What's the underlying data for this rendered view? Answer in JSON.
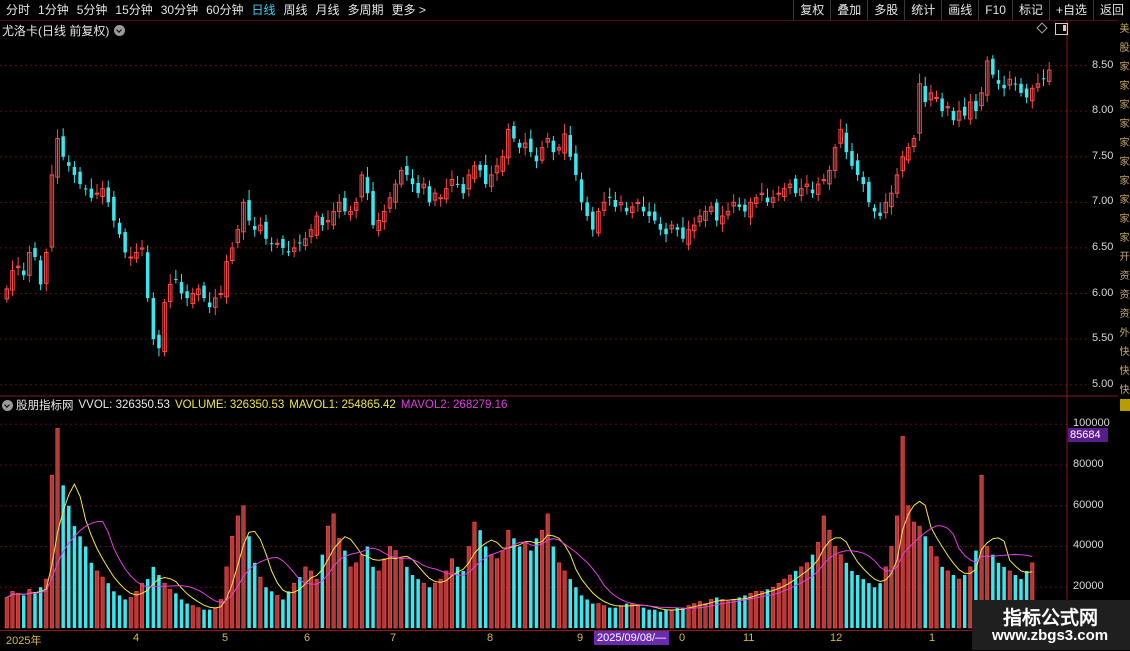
{
  "toolbar": {
    "periods": [
      {
        "label": "分时",
        "active": false
      },
      {
        "label": "1分钟",
        "active": false
      },
      {
        "label": "5分钟",
        "active": false
      },
      {
        "label": "15分钟",
        "active": false
      },
      {
        "label": "30分钟",
        "active": false
      },
      {
        "label": "60分钟",
        "active": false
      },
      {
        "label": "日线",
        "active": true
      },
      {
        "label": "周线",
        "active": false
      },
      {
        "label": "月线",
        "active": false
      },
      {
        "label": "多周期",
        "active": false
      },
      {
        "label": "更多 >",
        "active": false
      }
    ],
    "actions": [
      "复权",
      "叠加",
      "多股",
      "统计",
      "画线",
      "F10",
      "标记",
      "+自选",
      "返回"
    ]
  },
  "title": "尤洛卡(日线 前复权)",
  "price_axis": [
    "8.50",
    "8.00",
    "7.50",
    "7.00",
    "6.50",
    "6.00",
    "5.50",
    "5.00"
  ],
  "indicator": {
    "name": "股朋指标网",
    "items": [
      {
        "text": "VVOL: 326350.53",
        "color": "#e8e8e8"
      },
      {
        "text": "VOLUME: 326350.53",
        "color": "#f0e64a"
      },
      {
        "text": "MAVOL1: 254865.42",
        "color": "#f0e64a"
      },
      {
        "text": "MAVOL2: 268279.16",
        "color": "#e040e0"
      }
    ]
  },
  "volume_axis": [
    "100000",
    "80000",
    "60000",
    "40000",
    "20000"
  ],
  "volume_tag": "85684",
  "dates": [
    {
      "label": "2025年"
    },
    {
      "label": "4"
    },
    {
      "label": "5"
    },
    {
      "label": "6"
    },
    {
      "label": "7"
    },
    {
      "label": "8"
    },
    {
      "label": "9"
    },
    {
      "label": "0"
    },
    {
      "label": "11"
    },
    {
      "label": "12"
    },
    {
      "label": "1"
    }
  ],
  "selected_date": "2025/09/08/—",
  "side_text": "美股家家家家家家家家家家开资资资外快快快",
  "watermark": {
    "cn": "指标公式网",
    "url": "www.zbgs3.com"
  },
  "colors": {
    "up": "#ff4a4a",
    "down": "#38e8f0",
    "grid": "#5c1010",
    "ma1": "#f0e64a",
    "ma2": "#e040e0"
  },
  "chart_data": {
    "type": "candlestick",
    "close": [
      6.05,
      6.25,
      6.3,
      6.2,
      6.45,
      6.4,
      6.1,
      6.45,
      7.3,
      7.7,
      7.5,
      7.4,
      7.3,
      7.2,
      7.15,
      7.05,
      7.1,
      7.15,
      7.0,
      6.8,
      6.65,
      6.45,
      6.4,
      6.45,
      6.5,
      5.95,
      5.5,
      5.4,
      5.9,
      6.1,
      6.15,
      6.0,
      5.95,
      6.0,
      6.05,
      5.95,
      5.85,
      5.95,
      6.0,
      6.35,
      6.5,
      6.7,
      7.0,
      6.8,
      6.7,
      6.75,
      6.6,
      6.55,
      6.55,
      6.5,
      6.45,
      6.5,
      6.55,
      6.6,
      6.7,
      6.85,
      6.75,
      6.8,
      6.9,
      7.0,
      6.9,
      6.9,
      7.0,
      7.3,
      7.1,
      6.75,
      6.8,
      6.9,
      7.05,
      7.2,
      7.35,
      7.3,
      7.2,
      7.1,
      7.2,
      7.0,
      7.1,
      7.05,
      7.15,
      7.25,
      7.2,
      7.1,
      7.3,
      7.4,
      7.35,
      7.2,
      7.3,
      7.4,
      7.5,
      7.8,
      7.7,
      7.6,
      7.65,
      7.55,
      7.45,
      7.6,
      7.7,
      7.55,
      7.6,
      7.75,
      7.5,
      7.3,
      7.0,
      6.85,
      6.7,
      6.9,
      7.0,
      7.05,
      6.95,
      7.0,
      6.9,
      6.95,
      7.0,
      6.9,
      6.85,
      6.8,
      6.7,
      6.65,
      6.75,
      6.7,
      6.6,
      6.7,
      6.75,
      6.85,
      6.9,
      6.95,
      6.8,
      6.85,
      6.9,
      7.0,
      6.95,
      6.9,
      7.0,
      7.05,
      7.1,
      7.0,
      7.05,
      7.1,
      7.15,
      7.2,
      7.1,
      7.15,
      7.2,
      7.1,
      7.2,
      7.25,
      7.35,
      7.6,
      7.8,
      7.55,
      7.4,
      7.3,
      7.2,
      7.0,
      6.9,
      6.85,
      7.0,
      7.1,
      7.3,
      7.5,
      7.6,
      7.7,
      8.3,
      8.1,
      8.2,
      8.15,
      8.0,
      8.05,
      7.9,
      8.0,
      7.95,
      8.1,
      8.0,
      8.2,
      8.55,
      8.4,
      8.3,
      8.25,
      8.35,
      8.3,
      8.2,
      8.15,
      8.25,
      8.3,
      8.35,
      8.45
    ],
    "volume": [
      15000,
      18000,
      17000,
      16000,
      19000,
      17000,
      20000,
      24000,
      75000,
      98000,
      70000,
      60000,
      50000,
      45000,
      40000,
      32000,
      28000,
      25000,
      22000,
      18000,
      16000,
      14000,
      15000,
      18000,
      22000,
      24000,
      30000,
      26000,
      22000,
      19000,
      17000,
      14000,
      12000,
      11000,
      10000,
      9000,
      9000,
      10000,
      14000,
      30000,
      45000,
      55000,
      60000,
      45000,
      32000,
      25000,
      20000,
      18000,
      16000,
      14000,
      18000,
      22000,
      25000,
      30000,
      28000,
      24000,
      36000,
      50000,
      56000,
      44000,
      38000,
      30000,
      32000,
      36000,
      40000,
      30000,
      28000,
      34000,
      40000,
      38000,
      34000,
      30000,
      26000,
      24000,
      22000,
      20000,
      22000,
      24000,
      28000,
      34000,
      30000,
      28000,
      40000,
      52000,
      48000,
      40000,
      36000,
      34000,
      38000,
      48000,
      44000,
      40000,
      42000,
      38000,
      44000,
      48000,
      56000,
      40000,
      32000,
      28000,
      24000,
      20000,
      16000,
      14000,
      12000,
      12000,
      11000,
      10000,
      10000,
      11000,
      12000,
      12000,
      11000,
      10000,
      9000,
      9000,
      8000,
      9000,
      9000,
      10000,
      10000,
      11000,
      12000,
      13000,
      12000,
      14000,
      15000,
      14000,
      13000,
      14000,
      15000,
      16000,
      17000,
      18000,
      18000,
      19000,
      20000,
      22000,
      24000,
      26000,
      28000,
      30000,
      32000,
      36000,
      42000,
      55000,
      48000,
      40000,
      36000,
      32000,
      28000,
      26000,
      24000,
      22000,
      20000,
      22000,
      30000,
      40000,
      55000,
      94000,
      60000,
      52000,
      50000,
      45000,
      40000,
      35000,
      30000,
      28000,
      26000,
      24000,
      26000,
      30000,
      38000,
      75000,
      40000,
      36000,
      32000,
      30000,
      28000,
      26000,
      24000,
      28000,
      32000
    ]
  }
}
